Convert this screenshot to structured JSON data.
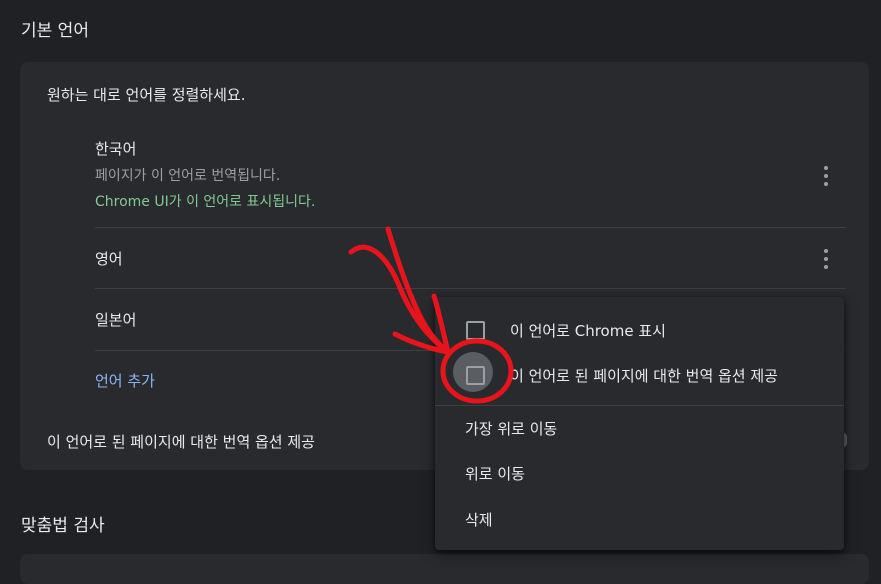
{
  "sections": {
    "default_language_title": "기본 언어",
    "spellcheck_title": "맞춤법 검사"
  },
  "card": {
    "instruction": "원하는 대로 언어를 정렬하세요.",
    "languages": [
      {
        "name": "한국어",
        "subtitle": "페이지가 이 언어로 번역됩니다.",
        "ui_note": "Chrome UI가 이 언어로 표시됩니다."
      },
      {
        "name": "영어"
      },
      {
        "name": "일본어"
      }
    ],
    "add_language": "언어 추가",
    "offer_translate": "이 언어로 된 페이지에 대한 번역 옵션 제공"
  },
  "context_menu": {
    "display_chrome": "이 언어로 Chrome 표시",
    "offer_translation": "이 언어로 된 페이지에 대한 번역 옵션 제공",
    "move_top": "가장 위로 이동",
    "move_up": "위로 이동",
    "remove": "삭제"
  },
  "colors": {
    "background": "#202124",
    "card": "#292a2d",
    "ui_note_green": "#81c995",
    "link_blue": "#8ab4f8",
    "annotation_red": "#e8141b"
  },
  "icons": [
    "more-vert-icon",
    "checkbox-icon"
  ]
}
